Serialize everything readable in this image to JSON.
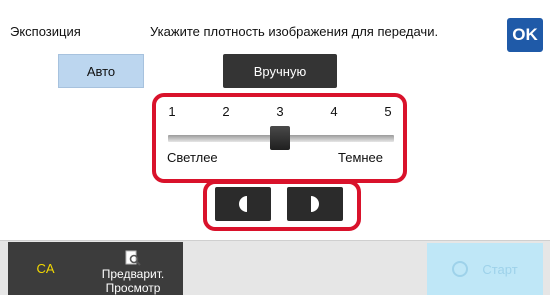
{
  "header": {
    "title": "Экспозиция",
    "prompt": "Укажите плотность изображения для передачи.",
    "ok_label": "OK"
  },
  "mode": {
    "auto_label": "Авто",
    "manual_label": "Вручную",
    "selected": "Вручную"
  },
  "density": {
    "ticks": [
      "1",
      "2",
      "3",
      "4",
      "5"
    ],
    "value": 3,
    "min": 1,
    "max": 5,
    "lighter_label": "Светлее",
    "darker_label": "Темнее"
  },
  "footer": {
    "ca_label": "CA",
    "preview_line1": "Предварит.",
    "preview_line2": "Просмотр",
    "start_label": "Старт"
  },
  "colors": {
    "ok": "#1f5aa8",
    "highlight_frame": "#d9122b",
    "ca_text": "#f2d800",
    "start_disabled": "#bfe7f7"
  }
}
